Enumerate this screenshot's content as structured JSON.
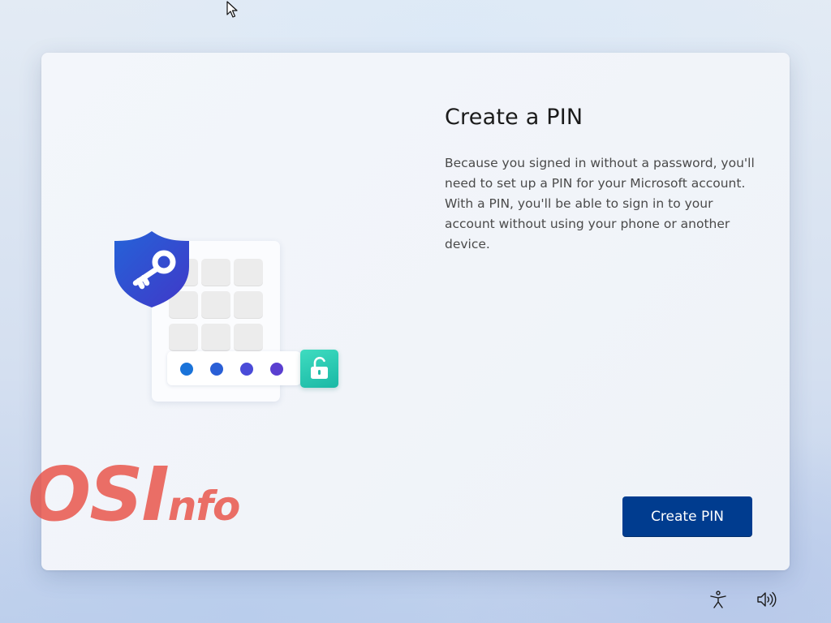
{
  "page": {
    "title": "Create a PIN",
    "description": "Because you signed in without a password, you'll need to set up a PIN for your Microsoft account. With a PIN, you'll be able to sign in to your account without using your phone or another device.",
    "primary_button": "Create PIN"
  },
  "illustration": {
    "icons": [
      "shield-key-icon",
      "keypad",
      "pin-dots",
      "unlock-icon"
    ],
    "pin_dot_colors": [
      "#1a73d9",
      "#2a5fd6",
      "#4a4bd8",
      "#5a3fd0"
    ],
    "lock_color": "#2cc8b2",
    "shield_color": "#2f55d4"
  },
  "watermark": {
    "big": "OSI",
    "small": "nfo"
  },
  "system_tray": {
    "icons": [
      "accessibility-icon",
      "volume-icon"
    ]
  },
  "colors": {
    "accent": "#003c8f",
    "button_text": "#ffffff"
  }
}
